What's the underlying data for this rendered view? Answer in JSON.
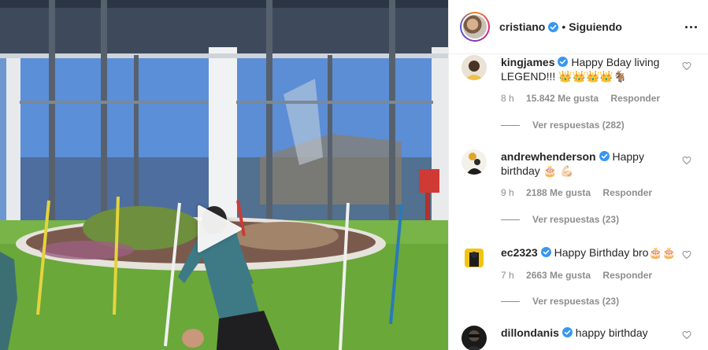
{
  "header": {
    "username": "cristiano",
    "separator": "•",
    "follow_status": "Siguiendo"
  },
  "comments": [
    {
      "username": "kingjames",
      "text": "Happy Bday living LEGEND!!! 👑👑👑👑🐐",
      "time": "8 h",
      "likes": "15.842 Me gusta",
      "reply": "Responder",
      "view_replies": "Ver respuestas (282)"
    },
    {
      "username": "andrewhenderson",
      "text": "Happy birthday 🎂 💪🏻",
      "time": "9 h",
      "likes": "2188 Me gusta",
      "reply": "Responder",
      "view_replies": "Ver respuestas (23)"
    },
    {
      "username": "ec2323",
      "text": "Happy Birthday bro🎂🎂",
      "time": "7 h",
      "likes": "2663 Me gusta",
      "reply": "Responder",
      "view_replies": "Ver respuestas (23)"
    },
    {
      "username": "dillondanis",
      "text": "happy birthday"
    }
  ],
  "colors": {
    "verified": "#3897f0",
    "muted": "#8e8e8e",
    "text": "#262626"
  },
  "icons": {
    "play": "play-icon",
    "verified": "verified-badge-icon",
    "more": "more-options-icon",
    "heart": "heart-icon"
  }
}
